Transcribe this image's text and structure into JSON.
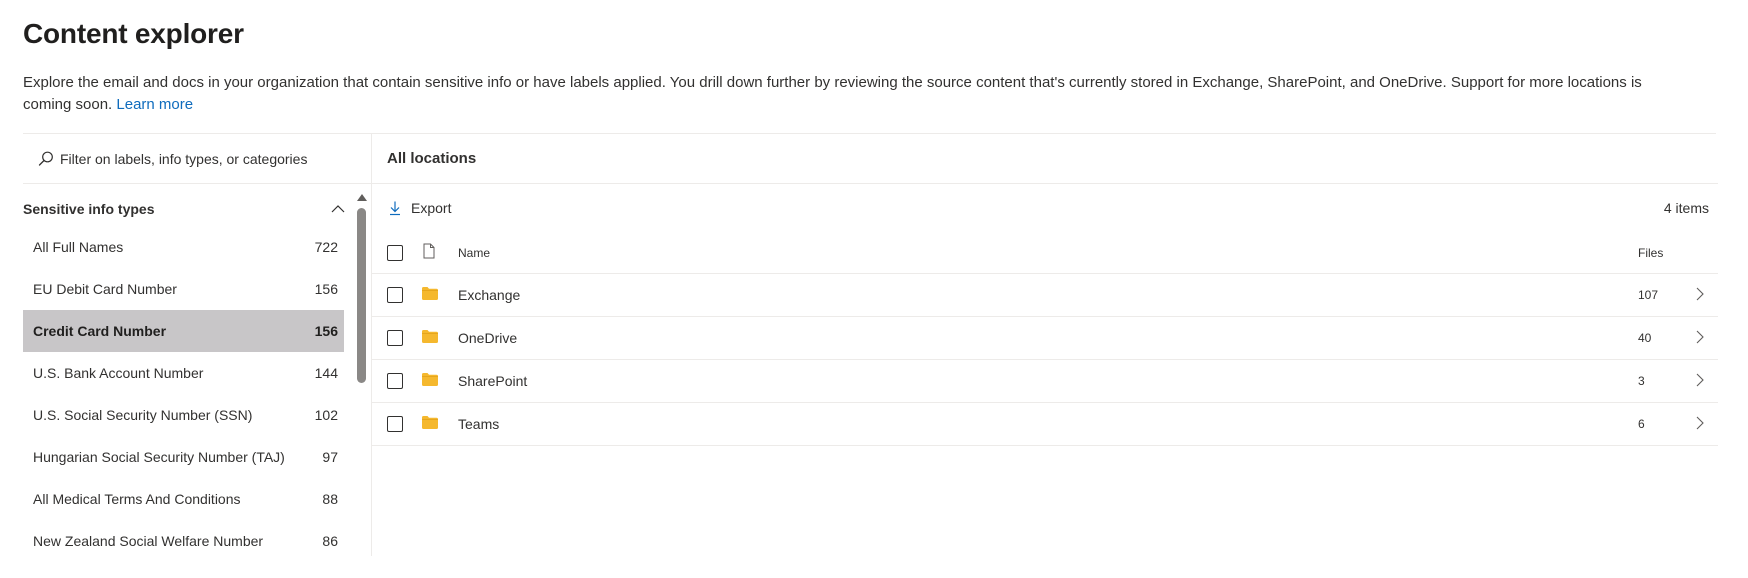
{
  "page": {
    "title": "Content explorer",
    "description": "Explore the email and docs in your organization that contain sensitive info or have labels applied. You drill down further by reviewing the source content that's currently stored in Exchange, SharePoint, and OneDrive. Support for more locations is coming soon.",
    "learn_more": "Learn more"
  },
  "filter": {
    "placeholder": "Filter on labels, info types, or categories",
    "icon": "search-icon"
  },
  "sidebar": {
    "group_title": "Sensitive info types",
    "items": [
      {
        "label": "All Full Names",
        "count": "722"
      },
      {
        "label": "EU Debit Card Number",
        "count": "156"
      },
      {
        "label": "Credit Card Number",
        "count": "156",
        "selected": true
      },
      {
        "label": "U.S. Bank Account Number",
        "count": "144"
      },
      {
        "label": "U.S. Social Security Number (SSN)",
        "count": "102"
      },
      {
        "label": "Hungarian Social Security Number (TAJ)",
        "count": "97"
      },
      {
        "label": "All Medical Terms And Conditions",
        "count": "88"
      },
      {
        "label": "New Zealand Social Welfare Number",
        "count": "86"
      }
    ]
  },
  "main": {
    "title": "All locations",
    "export_label": "Export",
    "item_count": "4 items",
    "columns": {
      "name": "Name",
      "files": "Files"
    },
    "rows": [
      {
        "name": "Exchange",
        "files": "107"
      },
      {
        "name": "OneDrive",
        "files": "40"
      },
      {
        "name": "SharePoint",
        "files": "3"
      },
      {
        "name": "Teams",
        "files": "6"
      }
    ]
  },
  "colors": {
    "folder": "#f5b82e",
    "link": "#0f6cbd",
    "selected_bg": "#c8c6c8"
  }
}
